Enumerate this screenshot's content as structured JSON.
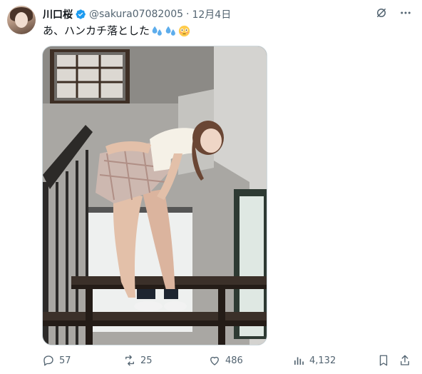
{
  "tweet": {
    "author_name": "川口桜",
    "handle": "@sakura07082005",
    "separator": "·",
    "date": "12月4日",
    "text": "あ、ハンカチ落とした",
    "verified": true
  },
  "icons": {
    "verified": "verified-badge-icon",
    "grok": "grok-icon",
    "more": "more-icon",
    "emoji_1": "sweat-droplets-icon",
    "emoji_2": "sweat-droplets-icon",
    "emoji_3": "flushed-face-icon"
  },
  "actions": {
    "replies": "57",
    "reposts": "25",
    "likes": "486",
    "views": "4,132"
  },
  "colors": {
    "verified": "#1d9bf0",
    "muted_text": "#536471",
    "primary_text": "#0f1419"
  }
}
